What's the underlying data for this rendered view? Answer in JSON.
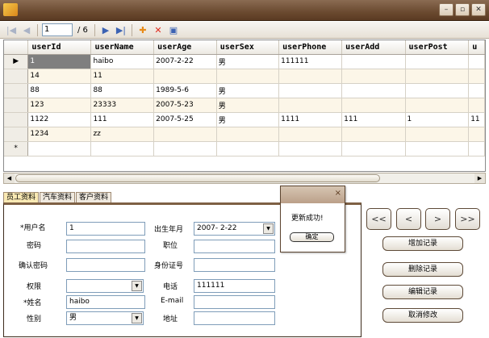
{
  "window": {
    "title": "",
    "buttons": [
      "–",
      "▫",
      "✕"
    ]
  },
  "toolbar": {
    "position": "1",
    "total": "/ 6"
  },
  "grid": {
    "columns": [
      "userId",
      "userName",
      "userAge",
      "userSex",
      "userPhone",
      "userAdd",
      "userPost",
      "u"
    ],
    "rows": [
      [
        "1",
        "haibo",
        "2007-2-22",
        "男",
        "111111",
        "",
        "",
        ""
      ],
      [
        "14",
        "11",
        "",
        "",
        "",
        "",
        "",
        ""
      ],
      [
        "88",
        "88",
        "1989-5-6",
        "男",
        "",
        "",
        "",
        ""
      ],
      [
        "123",
        "23333",
        "2007-5-23",
        "男",
        "",
        "",
        "",
        ""
      ],
      [
        "1122",
        "111",
        "2007-5-25",
        "男",
        "1111",
        "111",
        "1",
        "11"
      ],
      [
        "1234",
        "zz",
        "",
        "",
        "",
        "",
        "",
        ""
      ],
      [
        "",
        "",
        "",
        "",
        "",
        "",
        "",
        ""
      ]
    ],
    "row_markers": [
      "▶",
      "",
      "",
      "",
      "",
      "",
      "*"
    ]
  },
  "tabs": [
    "员工资料",
    "汽车资料",
    "客户资料"
  ],
  "form": {
    "username_label": "*用户名",
    "username_value": "1",
    "password_label": "密码",
    "confirm_label": "确认密码",
    "permission_label": "权限",
    "name_label": "*姓名",
    "name_value": "haibo",
    "gender_label": "性别",
    "gender_value": "男",
    "birth_label": "出生年月",
    "birth_value": "2007- 2-22",
    "position_label": "职位",
    "idcard_label": "身份证号",
    "phone_label": "电话",
    "phone_value": "111111",
    "email_label": "E-mail",
    "address_label": "地址"
  },
  "dialog": {
    "message": "更新成功!",
    "ok_label": "确定",
    "close": "×"
  },
  "nav": {
    "first": "<<",
    "prev": "<",
    "next": ">",
    "last": ">>"
  },
  "actions": {
    "add": "增加记录",
    "delete": "删除记录",
    "edit": "编辑记录",
    "cancel": "取消修改"
  }
}
